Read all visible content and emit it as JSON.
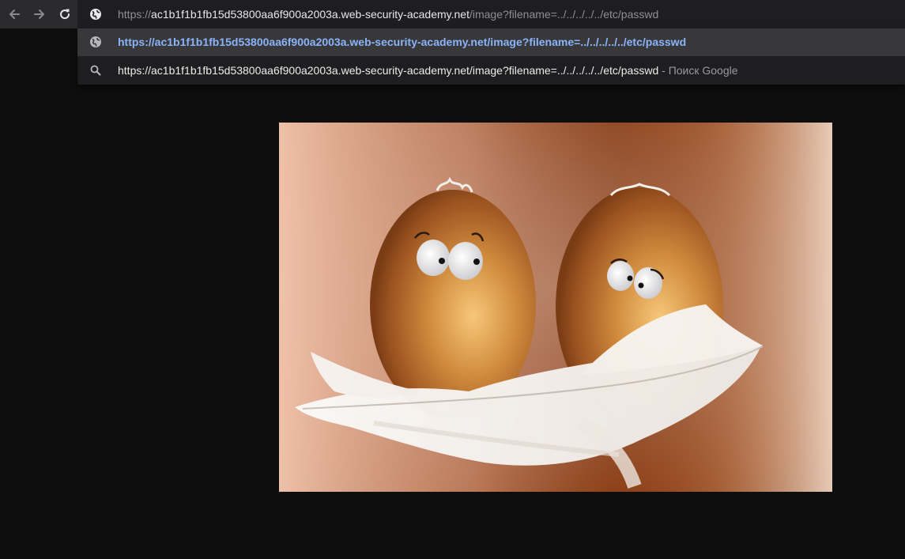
{
  "browser": {
    "address_bar": {
      "scheme": "https://",
      "host": "ac1b1f1b1fb15d53800aa6f900a2003a.web-security-academy.net",
      "path": "/image?filename=../../../../../etc/passwd"
    },
    "suggestions": [
      {
        "icon": "globe-icon",
        "text": "https://ac1b1f1b1fb15d53800aa6f900a2003a.web-security-academy.net/image?filename=../../../../../etc/passwd"
      },
      {
        "icon": "search-icon",
        "text": "https://ac1b1f1b1fb15d53800aa6f900a2003a.web-security-academy.net/image?filename=../../../../../etc/passwd",
        "separator": " - ",
        "engine": "Поиск Google"
      }
    ],
    "nav_icons": [
      "back-arrow-icon",
      "forward-arrow-icon",
      "reload-icon"
    ]
  },
  "colors": {
    "page_background": "#0e0e0e",
    "toolbar": "#2b2b2d",
    "highlight_link": "#8ab4f8"
  },
  "image": {
    "description_name": "two-eggs-on-feather"
  }
}
